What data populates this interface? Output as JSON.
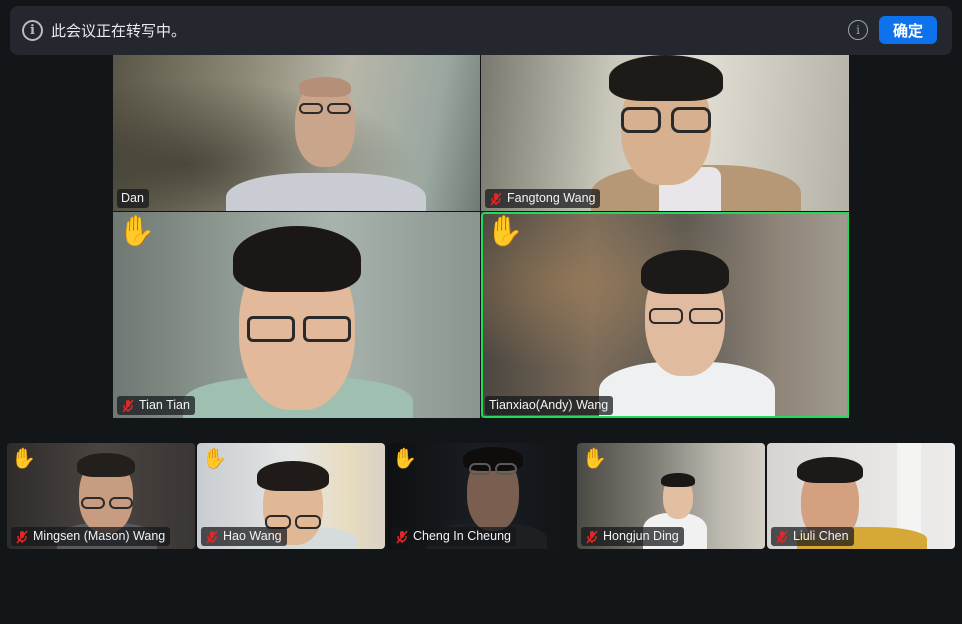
{
  "banner": {
    "message": "此会议正在转写中。",
    "confirm_label": "确定",
    "info_icon": "info-circle-icon"
  },
  "main_grid": [
    {
      "name": "Dan",
      "muted": false,
      "hand_raised": false,
      "active_speaker": false
    },
    {
      "name": "Fangtong Wang",
      "muted": true,
      "hand_raised": false,
      "active_speaker": false
    },
    {
      "name": "Tian Tian",
      "muted": true,
      "hand_raised": true,
      "active_speaker": false
    },
    {
      "name": "Tianxiao(Andy) Wang",
      "muted": false,
      "hand_raised": true,
      "active_speaker": true
    }
  ],
  "strip": [
    {
      "name": "Mingsen (Mason) Wang",
      "muted": true,
      "hand_raised": true
    },
    {
      "name": "Hao Wang",
      "muted": true,
      "hand_raised": true
    },
    {
      "name": "Cheng In Cheung",
      "muted": true,
      "hand_raised": true
    },
    {
      "name": "Hongjun Ding",
      "muted": true,
      "hand_raised": true
    },
    {
      "name": "Liuli Chen",
      "muted": true,
      "hand_raised": false
    }
  ],
  "colors": {
    "background": "#131619",
    "banner": "#24282e",
    "confirm_button": "#0e72ed",
    "active_speaker_border": "#23d959",
    "muted_icon": "#e02828",
    "hand": "#f5c23a"
  },
  "icons": {
    "hand": "raised-hand-icon",
    "mic": "microphone-muted-icon"
  }
}
